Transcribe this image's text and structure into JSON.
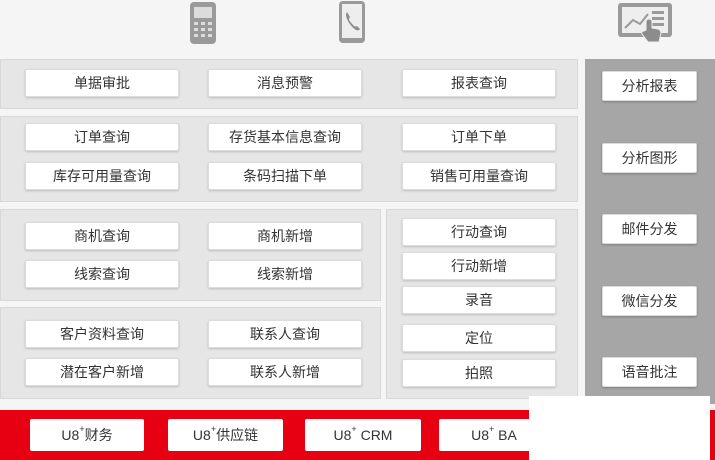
{
  "top_icons": [
    "mobile-phone-icon",
    "phone-call-icon",
    "touch-report-icon"
  ],
  "panel_approval": [
    "单据审批",
    "消息预警",
    "报表查询"
  ],
  "panel_orders": [
    "订单查询",
    "存货基本信息查询",
    "订单下单",
    "库存可用量查询",
    "条码扫描下单",
    "销售可用量查询"
  ],
  "panel_opportunity": [
    "商机查询",
    "商机新增",
    "线索查询",
    "线索新增"
  ],
  "panel_customer": [
    "客户资料查询",
    "联系人查询",
    "潜在客户新增",
    "联系人新增"
  ],
  "panel_actions": [
    "行动查询",
    "行动新增",
    "录音",
    "定位",
    "拍照"
  ],
  "right_menu": [
    "分析报表",
    "分析图形",
    "邮件分发",
    "微信分发",
    "语音批注"
  ],
  "bottom_tabs": [
    {
      "prefix": "U8",
      "sup": "+",
      "suffix": "财务"
    },
    {
      "prefix": "U8",
      "sup": "+",
      "suffix": "供应链"
    },
    {
      "prefix": "U8",
      "sup": "+",
      "suffix": " CRM"
    },
    {
      "prefix": "U8",
      "sup": "+",
      "suffix": " BA"
    }
  ],
  "colors": {
    "accent_red": "#e60012",
    "side_gray": "#a6a6a6",
    "panel_gray": "#e6e6e6",
    "icon_gray": "#9a9a9a"
  }
}
